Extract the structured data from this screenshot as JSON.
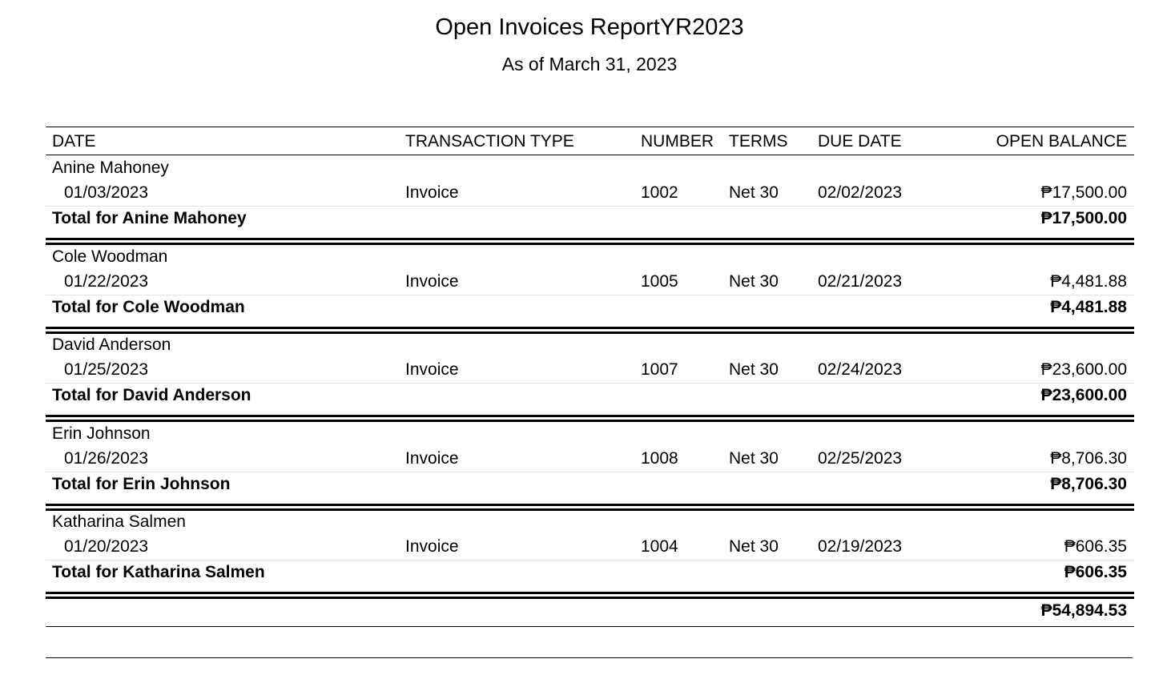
{
  "report": {
    "title": "Open Invoices ReportYR2023",
    "subtitle": "As of March 31, 2023"
  },
  "columns": {
    "date": "DATE",
    "type": "TRANSACTION TYPE",
    "number": "NUMBER",
    "terms": "TERMS",
    "due": "DUE DATE",
    "balance": "OPEN BALANCE"
  },
  "groups": [
    {
      "customer": "Anine Mahoney",
      "row": {
        "date": "01/03/2023",
        "type": "Invoice",
        "number": "1002",
        "terms": "Net 30",
        "due": "02/02/2023",
        "balance": "₱17,500.00"
      },
      "total_label": "Total for Anine Mahoney",
      "total": "₱17,500.00"
    },
    {
      "customer": "Cole Woodman",
      "row": {
        "date": "01/22/2023",
        "type": "Invoice",
        "number": "1005",
        "terms": "Net 30",
        "due": "02/21/2023",
        "balance": "₱4,481.88"
      },
      "total_label": "Total for Cole Woodman",
      "total": "₱4,481.88"
    },
    {
      "customer": "David Anderson",
      "row": {
        "date": "01/25/2023",
        "type": "Invoice",
        "number": "1007",
        "terms": "Net 30",
        "due": "02/24/2023",
        "balance": "₱23,600.00"
      },
      "total_label": "Total for David Anderson",
      "total": "₱23,600.00"
    },
    {
      "customer": "Erin Johnson",
      "row": {
        "date": "01/26/2023",
        "type": "Invoice",
        "number": "1008",
        "terms": "Net 30",
        "due": "02/25/2023",
        "balance": "₱8,706.30"
      },
      "total_label": "Total for Erin Johnson",
      "total": "₱8,706.30"
    },
    {
      "customer": "Katharina Salmen",
      "row": {
        "date": "01/20/2023",
        "type": "Invoice",
        "number": "1004",
        "terms": "Net 30",
        "due": "02/19/2023",
        "balance": "₱606.35"
      },
      "total_label": "Total for Katharina Salmen",
      "total": "₱606.35"
    }
  ],
  "grand_total": "₱54,894.53"
}
